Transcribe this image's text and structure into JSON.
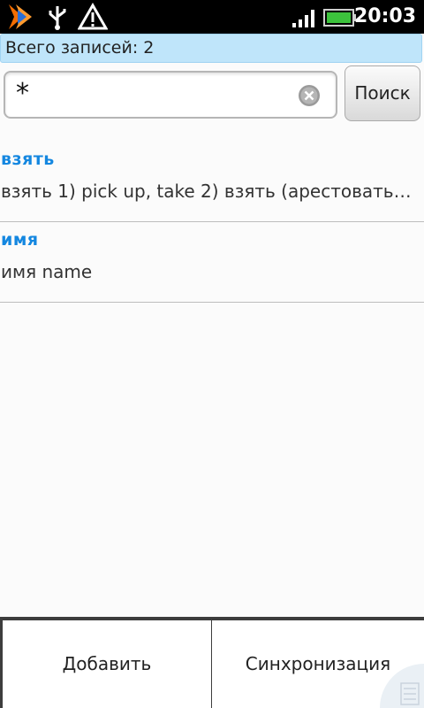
{
  "status_bar": {
    "time": "20:03",
    "icons": [
      "app-arrow-icon",
      "usb-icon",
      "warning-icon",
      "signal-icon",
      "battery-icon"
    ],
    "colors": {
      "app_icon": "#ff7a00",
      "battery": "#3cc23c"
    }
  },
  "count_bar": {
    "text": "Всего записей: 2"
  },
  "search": {
    "value": "*",
    "button_label": "Поиск"
  },
  "list": {
    "items": [
      {
        "word": "взять",
        "description": "взять 1) pick up, take 2) взять (арестовать) …"
      },
      {
        "word": "имя",
        "description": "имя name"
      }
    ]
  },
  "bottom_bar": {
    "add_label": "Добавить",
    "sync_label": "Синхронизация"
  },
  "colors": {
    "accent": "#1487e0",
    "count_bar_bg": "#bfe5fa"
  }
}
